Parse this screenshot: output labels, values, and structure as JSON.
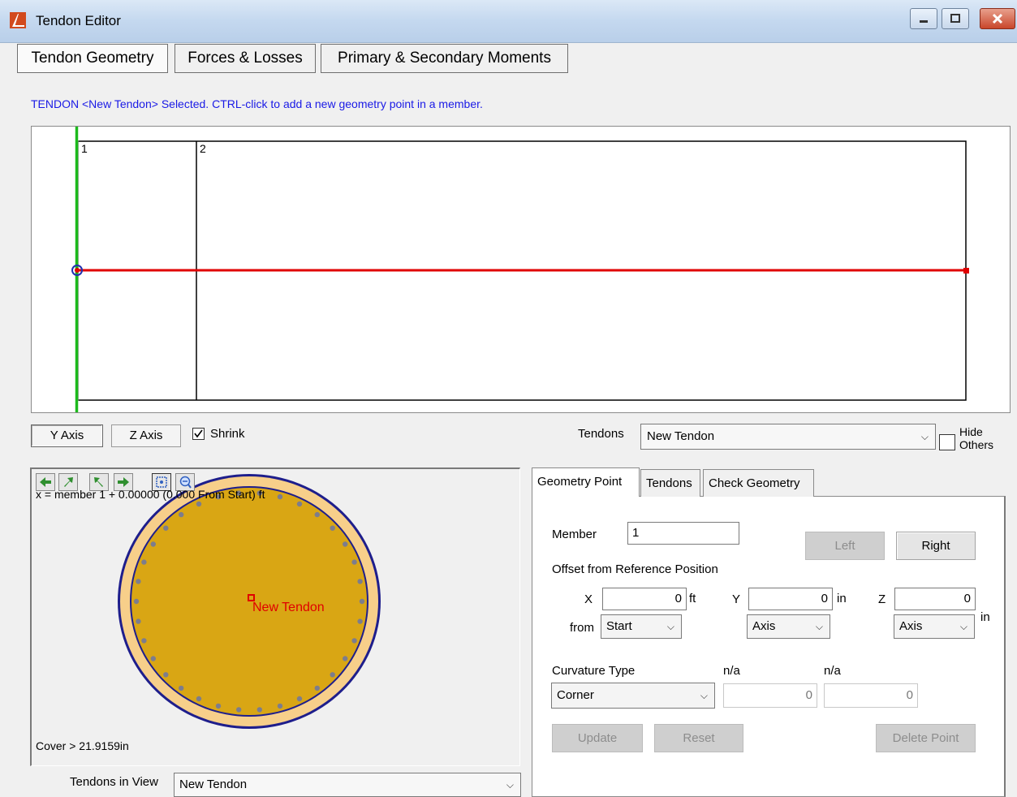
{
  "window": {
    "title": "Tendon Editor"
  },
  "tabs": [
    "Tendon Geometry",
    "Forces & Losses",
    "Primary & Secondary Moments"
  ],
  "status_message": "TENDON <New Tendon> Selected.  CTRL-click to add a new geometry point in a member.",
  "diagram": {
    "member_labels": [
      "1",
      "2"
    ]
  },
  "axis_buttons": {
    "y": "Y Axis",
    "z": "Z Axis"
  },
  "shrink": {
    "label": "Shrink",
    "checked": true
  },
  "tendons": {
    "label": "Tendons",
    "selected": "New Tendon"
  },
  "hide_others": {
    "label_line1": "Hide",
    "label_line2": "Others",
    "checked": false
  },
  "section": {
    "x_readout": "x = member 1 + 0.00000 (0.000 From Start) ft",
    "tendon_label": "New Tendon",
    "cover": "Cover > 21.9159in",
    "tendons_in_view_label": "Tendons in View",
    "tendons_in_view_value": "New Tendon"
  },
  "right_tabs": [
    "Geometry Point",
    "Tendons",
    "Check Geometry"
  ],
  "geometry_point": {
    "member_label": "Member",
    "member_value": "1",
    "left_button": "Left",
    "right_button": "Right",
    "offset_heading": "Offset from Reference Position",
    "x_label": "X",
    "x_value": "0",
    "x_unit": "ft",
    "y_label": "Y",
    "y_value": "0",
    "y_unit": "in",
    "z_label": "Z",
    "z_value": "0",
    "z_unit": "in",
    "from_label": "from",
    "from_value": "Start",
    "y_ref": "Axis",
    "z_ref": "Axis",
    "curvature_label": "Curvature Type",
    "curvature_value": "Corner",
    "na1_label": "n/a",
    "na1_value": "0",
    "na2_label": "n/a",
    "na2_value": "0",
    "update_button": "Update",
    "reset_button": "Reset",
    "delete_button": "Delete Point"
  },
  "colors": {
    "tendon": "#e00000",
    "section_fill": "#d9a614",
    "section_ring": "#f7cf8a",
    "status_text": "#1a1ae6"
  }
}
